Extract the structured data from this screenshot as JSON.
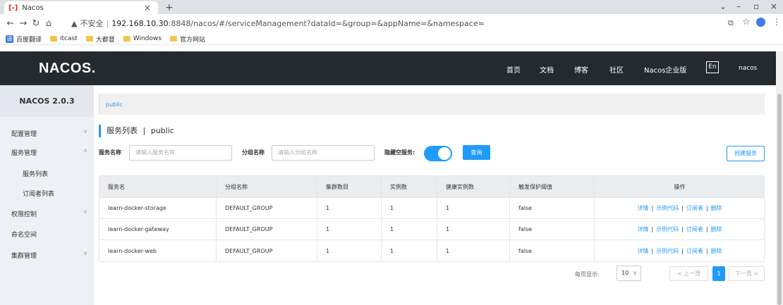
{
  "browser": {
    "tab_title": "Nacos",
    "tab_favicon": "[-]",
    "url_warning": "不安全",
    "url_host": "192.168.10.30",
    "url_rest": ":8848/nacos/#/serviceManagement?dataId=&group=&appName=&namespace=",
    "bookmarks": [
      "百度翻译",
      "itcast",
      "大都督",
      "Windows",
      "官方网站"
    ]
  },
  "header": {
    "logo": "NACOS.",
    "nav": [
      "首页",
      "文档",
      "博客",
      "社区",
      "Nacos企业版"
    ],
    "lang": "En",
    "user": "nacos"
  },
  "sidebar": {
    "version": "NACOS 2.0.3",
    "items": [
      {
        "label": "配置管理"
      },
      {
        "label": "服务管理"
      },
      {
        "label": "服务列表"
      },
      {
        "label": "订阅者列表"
      },
      {
        "label": "权限控制"
      },
      {
        "label": "命名空间"
      },
      {
        "label": "集群管理"
      }
    ]
  },
  "main": {
    "breadcrumb": "public",
    "title": "服务列表",
    "title_sep": "|",
    "title_ns": "public",
    "filters": {
      "service_label": "服务名称",
      "service_placeholder": "请输入服务名称",
      "group_label": "分组名称",
      "group_placeholder": "请输入分组名称",
      "hide_empty_label": "隐藏空服务:",
      "query_button": "查询",
      "create_button": "创建服务"
    },
    "table": {
      "headers": [
        "服务名",
        "分组名称",
        "集群数目",
        "实例数",
        "健康实例数",
        "触发保护阈值",
        "操作"
      ],
      "rows": [
        {
          "name": "learn-docker-storage",
          "group": "DEFAULT_GROUP",
          "clusters": "1",
          "instances": "1",
          "healthy": "1",
          "threshold": "false"
        },
        {
          "name": "learn-docker-gateway",
          "group": "DEFAULT_GROUP",
          "clusters": "1",
          "instances": "1",
          "healthy": "1",
          "threshold": "false"
        },
        {
          "name": "learn-docker-web",
          "group": "DEFAULT_GROUP",
          "clusters": "1",
          "instances": "1",
          "healthy": "1",
          "threshold": "false"
        }
      ],
      "ops": [
        "详情",
        "示例代码",
        "订阅者",
        "删除"
      ]
    },
    "pagination": {
      "page_size_label": "每页显示:",
      "page_size": "10",
      "prev": "< 上一页",
      "page": "1",
      "next": "下一页 >"
    }
  },
  "colors": {
    "accent": "#209bfa",
    "header_bg": "#252a2f",
    "sidebar_bg": "#eef0f5"
  }
}
